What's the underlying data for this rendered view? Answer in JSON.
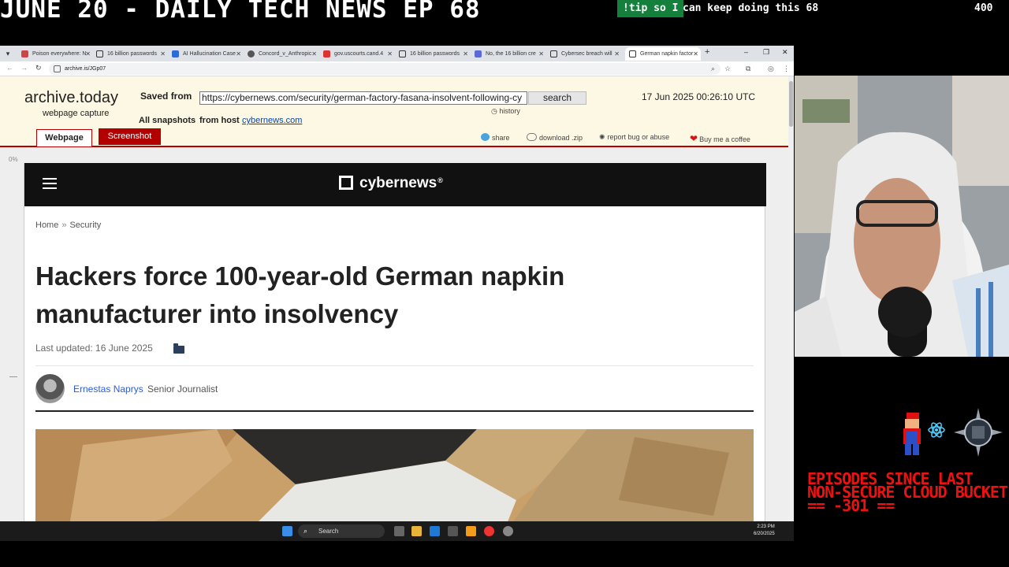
{
  "stream": {
    "title": "JUNE 20 - DAILY TECH NEWS EP 68",
    "tip_badge": "!tip so I",
    "tip_rest": "can keep doing this 68",
    "tip_count": "400",
    "counter_text": "EPISODES SINCE LAST NON-SECURE CLOUD BUCKET == -301 =="
  },
  "browser": {
    "tabs": [
      {
        "label": "Poison everywhere: N"
      },
      {
        "label": "16 billion passwords"
      },
      {
        "label": "AI Hallucination Case"
      },
      {
        "label": "Concord_v_Anthropic"
      },
      {
        "label": "gov.uscourts.cand.4"
      },
      {
        "label": "16 billion passwords"
      },
      {
        "label": "No, the 16 billion cre"
      },
      {
        "label": "Cybersec breach will"
      },
      {
        "label": "German napkin factor"
      }
    ],
    "url": "archive.is/JGp07"
  },
  "archive": {
    "logo": "archive.today",
    "logo_sub": "webpage capture",
    "saved_from_label": "Saved from",
    "saved_url": "https://cybernews.com/security/german-factory-fasana-insolvent-following-cy",
    "search_label": "search",
    "history_label": "history",
    "timestamp": "17 Jun 2025 00:26:10 UTC",
    "all_snapshots": "All snapshots",
    "from_host": "from host",
    "host": "cybernews.com",
    "tab_webpage": "Webpage",
    "tab_screenshot": "Screenshot",
    "actions": {
      "share": "share",
      "download": "download .zip",
      "report": "report bug or abuse",
      "coffee": "Buy me a coffee"
    },
    "zoom": "0%"
  },
  "article": {
    "site_name": "cybernews",
    "reg_mark": "®",
    "breadcrumb": [
      "Home",
      "Security"
    ],
    "breadcrumb_sep": "»",
    "headline": "Hackers force 100-year-old German napkin manufacturer into insolvency",
    "last_updated": "Last updated: 16 June 2025",
    "author": "Ernestas Naprys",
    "author_role": "Senior Journalist"
  },
  "taskbar": {
    "search_label": "Search",
    "time": "2:23 PM",
    "date": "6/20/2025"
  },
  "colors": {
    "archive_red": "#b30000",
    "archive_bg": "#fcf8e3",
    "counter_red": "#ee1111",
    "tip_green": "#14803c",
    "author_blue": "#2a5bd7"
  }
}
